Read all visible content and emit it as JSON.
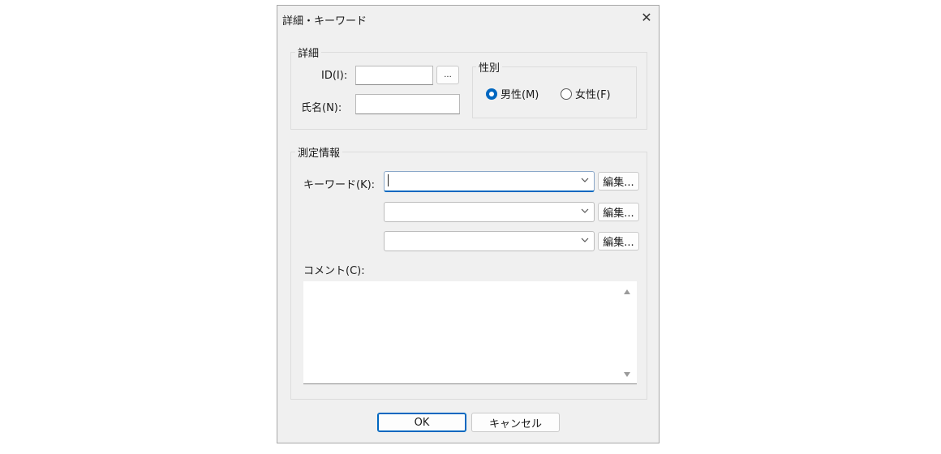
{
  "window": {
    "title": "詳細・キーワード",
    "close_glyph": "✕"
  },
  "details": {
    "legend": "詳細",
    "id_label": "ID(I):",
    "id_value": "",
    "browse_label": "...",
    "name_label": "氏名(N):",
    "name_value": ""
  },
  "gender": {
    "legend": "性別",
    "male_label": "男性(M)",
    "female_label": "女性(F)",
    "selected": "male"
  },
  "measurement": {
    "legend": "測定情報",
    "keyword_label": "キーワード(K):",
    "keywords": [
      "",
      "",
      ""
    ],
    "edit_label": "編集...",
    "comment_label": "コメント(C):",
    "comment_value": ""
  },
  "footer": {
    "ok_label": "OK",
    "cancel_label": "キャンセル"
  },
  "colors": {
    "accent": "#0067c0",
    "dialog_bg": "#f0f0f0"
  },
  "icons": [
    "close-icon",
    "chevron-down-icon",
    "scroll-up-icon",
    "scroll-down-icon"
  ]
}
